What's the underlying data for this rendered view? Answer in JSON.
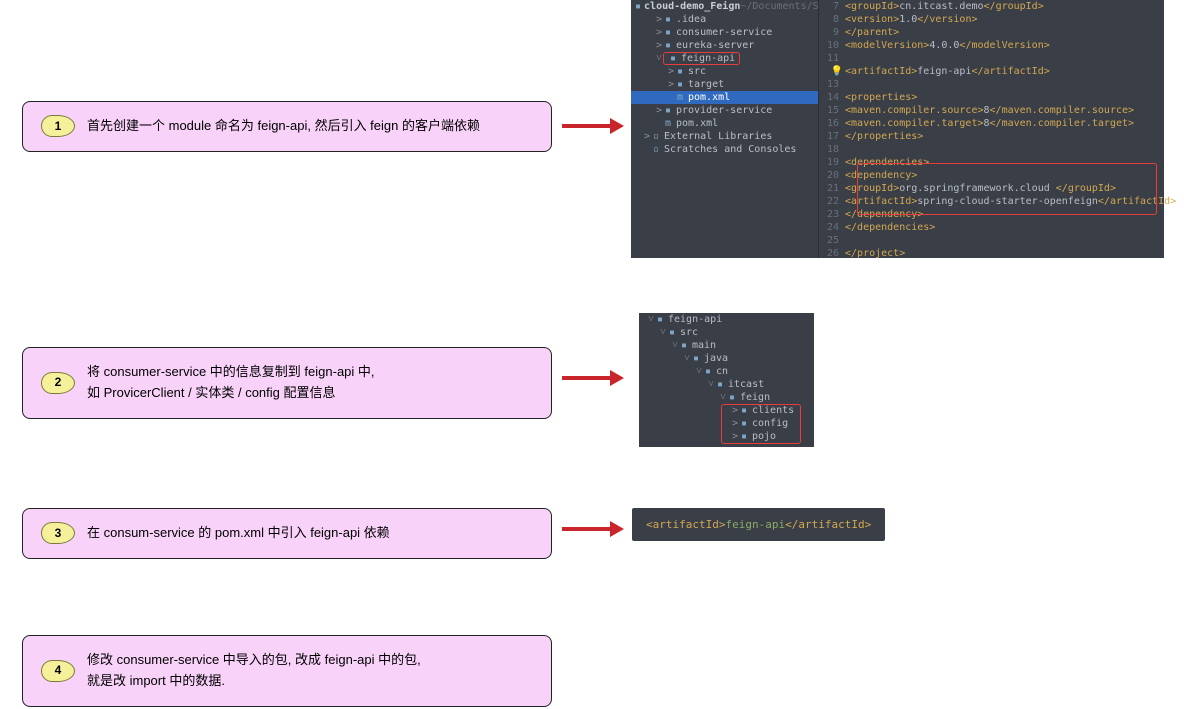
{
  "steps": [
    {
      "num": "1",
      "text": "首先创建一个 module 命名为 feign-api, 然后引入 feign 的客户端依赖"
    },
    {
      "num": "2",
      "text1": "将 consumer-service 中的信息复制到 feign-api 中,",
      "text2": "如 ProvicerClient / 实体类 / config 配置信息"
    },
    {
      "num": "3",
      "text": "在 consum-service 的 pom.xml 中引入 feign-api 依赖"
    },
    {
      "num": "4",
      "text1": "修改 consumer-service 中导入的包, 改成 feign-api 中的包,",
      "text2": "就是改 import 中的数据."
    }
  ],
  "projectTree": {
    "root": "cloud-demo_Feign",
    "rootHint": "~/Documents/Study/Git/Java/Sprin",
    "items": [
      {
        "indent": 1,
        "chev": ">",
        "icon": "▪",
        "label": ".idea"
      },
      {
        "indent": 1,
        "chev": ">",
        "icon": "▪",
        "label": "consumer-service"
      },
      {
        "indent": 1,
        "chev": ">",
        "icon": "▪",
        "label": "eureka-server"
      },
      {
        "indent": 1,
        "chev": "˅",
        "icon": "▪",
        "label": "feign-api",
        "redbox": true
      },
      {
        "indent": 2,
        "chev": ">",
        "icon": "▪",
        "label": "src"
      },
      {
        "indent": 2,
        "chev": ">",
        "icon": "▪",
        "label": "target"
      },
      {
        "indent": 2,
        "chev": "",
        "icon": "m",
        "label": "pom.xml",
        "selected": true
      },
      {
        "indent": 1,
        "chev": ">",
        "icon": "▪",
        "label": "provider-service"
      },
      {
        "indent": 1,
        "chev": "",
        "icon": "m",
        "label": "pom.xml"
      },
      {
        "indent": 0,
        "chev": ">",
        "icon": "▫",
        "label": "External Libraries"
      },
      {
        "indent": 0,
        "chev": "",
        "icon": "▫",
        "label": "Scratches and Consoles"
      }
    ]
  },
  "pom": [
    {
      "n": "7",
      "txt": "        <groupId>cn.itcast.demo</groupId>"
    },
    {
      "n": "8",
      "txt": "        <version>1.0</version>"
    },
    {
      "n": "9",
      "txt": "    </parent>"
    },
    {
      "n": "10",
      "txt": "    <modelVersion>4.0.0</modelVersion>"
    },
    {
      "n": "11",
      "txt": ""
    },
    {
      "n": "12",
      "txt": "    <artifactId>feign-api</artifactId>",
      "bulb": true
    },
    {
      "n": "13",
      "txt": ""
    },
    {
      "n": "14",
      "txt": "    <properties>"
    },
    {
      "n": "15",
      "txt": "        <maven.compiler.source>8</maven.compiler.source>"
    },
    {
      "n": "16",
      "txt": "        <maven.compiler.target>8</maven.compiler.target>"
    },
    {
      "n": "17",
      "txt": "    </properties>"
    },
    {
      "n": "18",
      "txt": ""
    },
    {
      "n": "19",
      "txt": "    <dependencies>"
    },
    {
      "n": "20",
      "txt": "        <dependency>",
      "red": "start"
    },
    {
      "n": "21",
      "txt": "            <groupId>org.springframework.cloud </groupId>"
    },
    {
      "n": "22",
      "txt": "            <artifactId>spring-cloud-starter-openfeign</artifactId>"
    },
    {
      "n": "23",
      "txt": "        </dependency>",
      "red": "end"
    },
    {
      "n": "24",
      "txt": "    </dependencies>"
    },
    {
      "n": "25",
      "txt": ""
    },
    {
      "n": "26",
      "txt": "</project>"
    }
  ],
  "pkgTree": [
    {
      "indent": 0,
      "chev": "˅",
      "icon": "▪",
      "label": "feign-api"
    },
    {
      "indent": 1,
      "chev": "˅",
      "icon": "▪",
      "label": "src"
    },
    {
      "indent": 2,
      "chev": "˅",
      "icon": "▪",
      "label": "main"
    },
    {
      "indent": 3,
      "chev": "˅",
      "icon": "▪",
      "label": "java"
    },
    {
      "indent": 4,
      "chev": "˅",
      "icon": "▪",
      "label": "cn"
    },
    {
      "indent": 5,
      "chev": "˅",
      "icon": "▪",
      "label": "itcast"
    },
    {
      "indent": 6,
      "chev": "˅",
      "icon": "▪",
      "label": "feign"
    },
    {
      "indent": 7,
      "chev": ">",
      "icon": "▪",
      "label": "clients",
      "red": "start"
    },
    {
      "indent": 7,
      "chev": ">",
      "icon": "▪",
      "label": "config"
    },
    {
      "indent": 7,
      "chev": ">",
      "icon": "▪",
      "label": "pojo",
      "red": "end"
    }
  ],
  "snippet3": {
    "open": "<artifactId>",
    "value": "feign-api",
    "close": "</artifactId>"
  }
}
